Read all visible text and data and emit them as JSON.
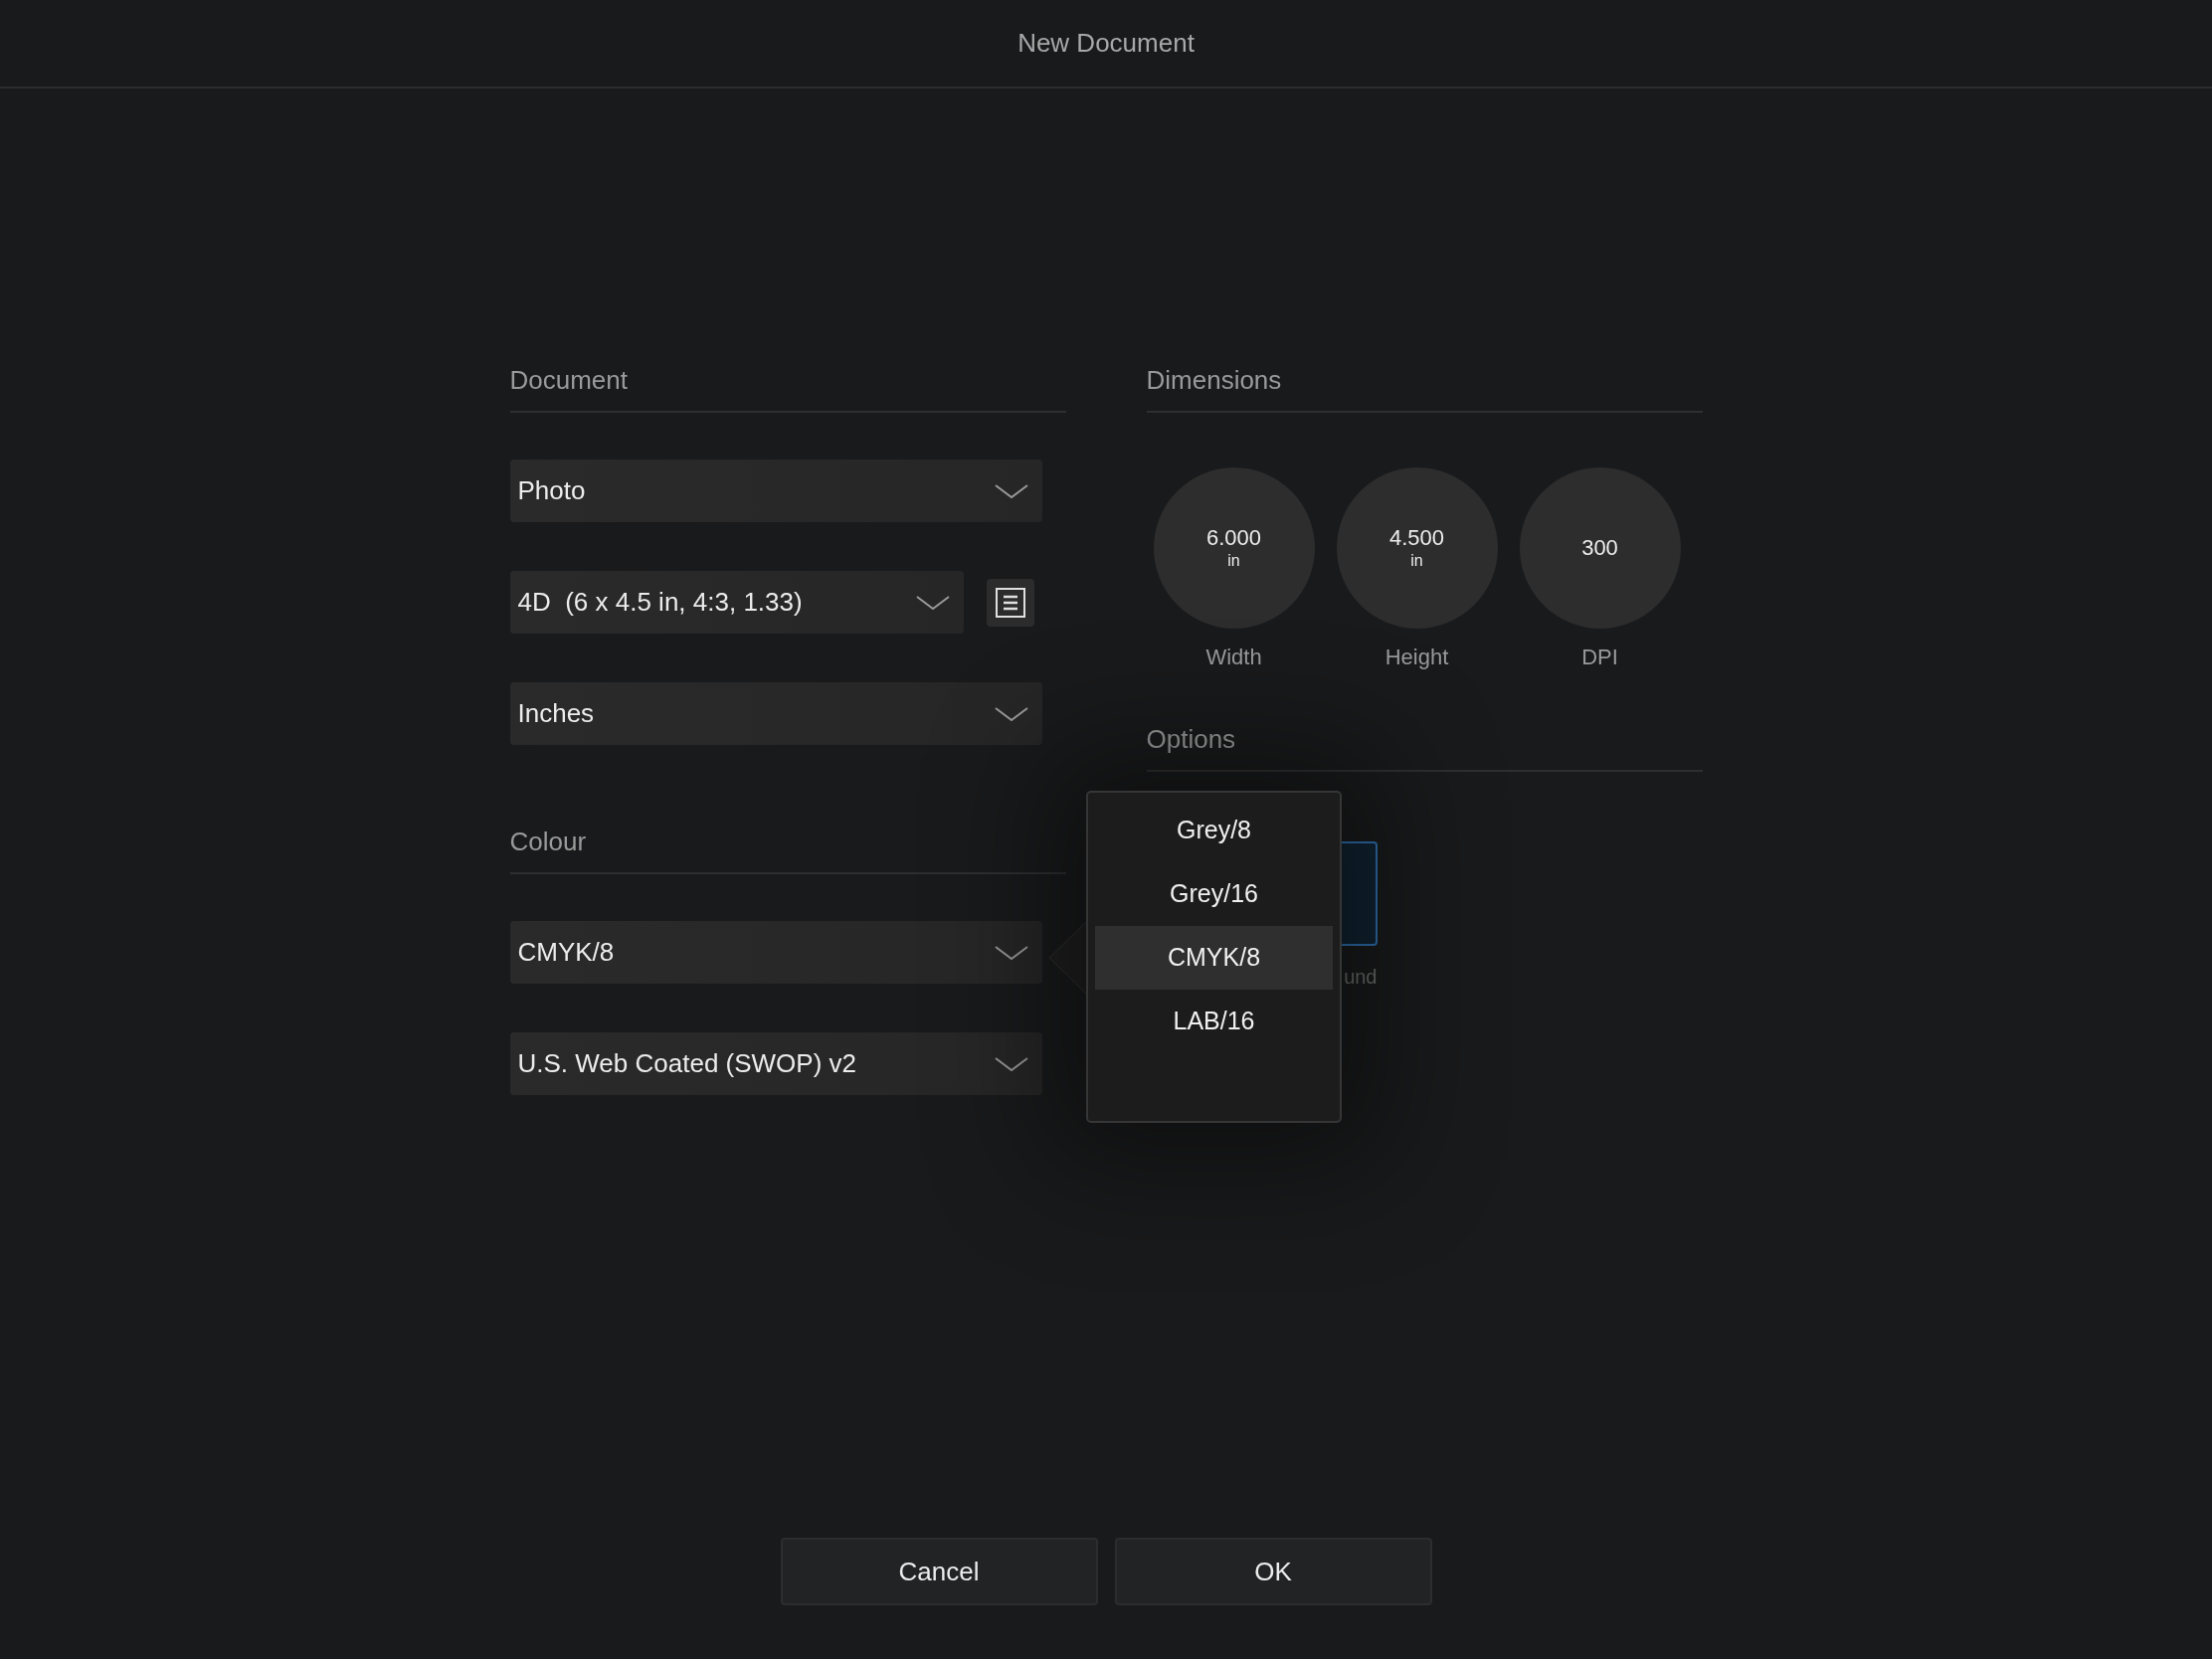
{
  "window": {
    "title": "New Document"
  },
  "document": {
    "heading": "Document",
    "preset_category": "Photo",
    "preset": "4D  (6 x 4.5 in, 4:3, 1.33)",
    "units": "Inches"
  },
  "colour": {
    "heading": "Colour",
    "format": "CMYK/8",
    "profile": "U.S. Web Coated (SWOP) v2"
  },
  "dimensions": {
    "heading": "Dimensions",
    "fields": [
      {
        "value": "6.000",
        "unit": "in",
        "label": "Width"
      },
      {
        "value": "4.500",
        "unit": "in",
        "label": "Height"
      },
      {
        "value": "300",
        "label": "DPI"
      }
    ]
  },
  "options": {
    "heading": "Options",
    "swatch_label": "und"
  },
  "format_menu": {
    "items": [
      {
        "label": "Grey/8",
        "selected": false
      },
      {
        "label": "Grey/16",
        "selected": false
      },
      {
        "label": "CMYK/8",
        "selected": true
      },
      {
        "label": "LAB/16",
        "selected": false
      }
    ]
  },
  "buttons": [
    {
      "label": "Cancel"
    },
    {
      "label": "OK"
    }
  ]
}
